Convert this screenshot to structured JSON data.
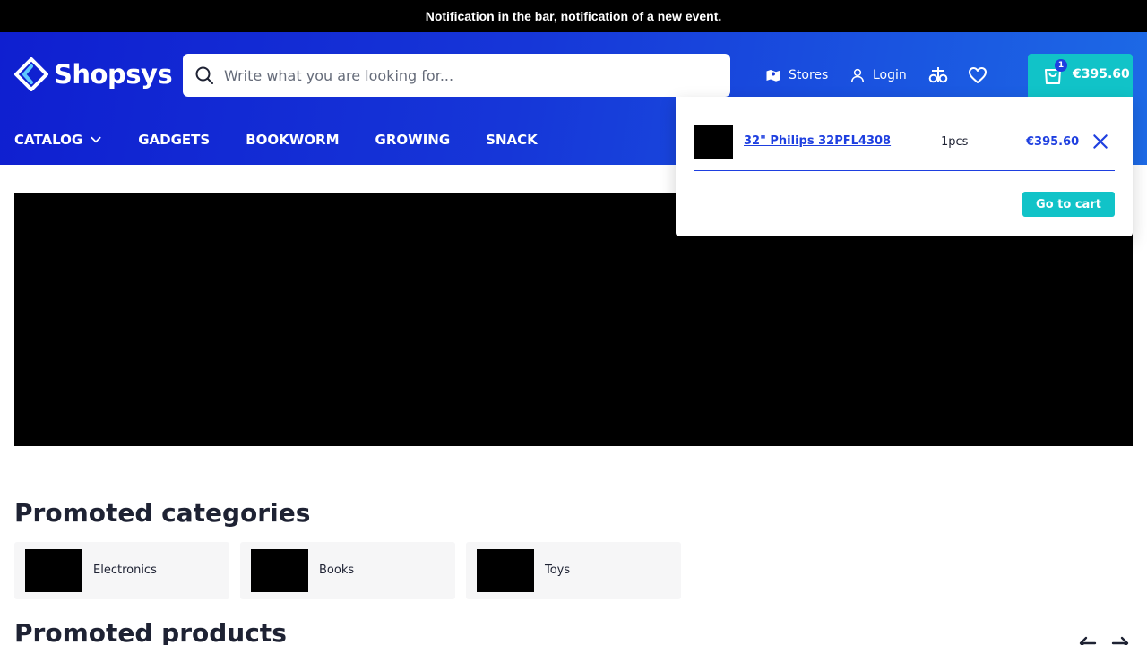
{
  "notification": {
    "text": "Notification in the bar, notification of a new event."
  },
  "header": {
    "logo_text": "Shopsys",
    "search": {
      "placeholder": "Write what you are looking for...",
      "value": ""
    },
    "links": {
      "stores": "Stores",
      "login": "Login"
    },
    "cart": {
      "count": "1",
      "total": "€395.60"
    }
  },
  "nav": {
    "items": [
      {
        "label": "CATALOG"
      },
      {
        "label": "GADGETS"
      },
      {
        "label": "BOOKWORM"
      },
      {
        "label": "GROWING"
      },
      {
        "label": "SNACK"
      }
    ]
  },
  "cart_dropdown": {
    "item": {
      "name": "32\" Philips 32PFL4308",
      "quantity": "1",
      "unit": "pcs",
      "price": "€395.60"
    },
    "go_to_cart": "Go to cart"
  },
  "promoted_categories": {
    "title": "Promoted categories",
    "items": [
      {
        "label": "Electronics"
      },
      {
        "label": "Books"
      },
      {
        "label": "Toys"
      }
    ]
  },
  "promoted_products": {
    "title": "Promoted products"
  },
  "colors": {
    "accent": "#11c3c8",
    "brand_blue": "#1e3fe0",
    "header_start": "#0f1fd0",
    "header_end": "#1d6ae6"
  }
}
